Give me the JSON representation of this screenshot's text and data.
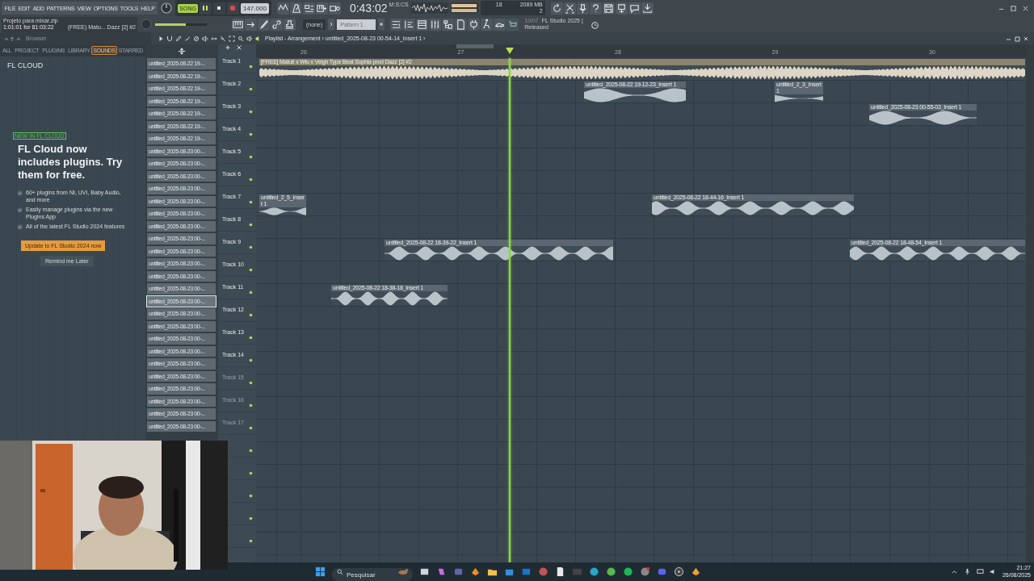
{
  "menu": [
    "FILE",
    "EDIT",
    "ADD",
    "PATTERNS",
    "VIEW",
    "OPTIONS",
    "TOOLS",
    "HELP"
  ],
  "hint_panel": {
    "title": "Projeto para mixar.zip",
    "position": "1:01:01 for 81:03:22",
    "song": "(FREE) Matu... Dazz [2] #2"
  },
  "transport": {
    "mode_label": "SONG",
    "song_mode": true,
    "playing": true,
    "tempo": "147.000"
  },
  "master_volume": {
    "level": 0.6
  },
  "time": {
    "value": "0:43:02",
    "unit": "M:S:CS"
  },
  "cpu": {
    "value": "18",
    "memory": "2089 MB",
    "polyphony": "2"
  },
  "pattern": {
    "mixer_target": "(none)",
    "name": "Pattern 1"
  },
  "news": {
    "date": "10/07",
    "title": "FL Studio 2025 |",
    "subtitle": "Released"
  },
  "browser": {
    "title": "Browser",
    "tabs": [
      {
        "label": "ALL",
        "selected": false
      },
      {
        "label": "PROJECT",
        "selected": false
      },
      {
        "label": "PLUGINS",
        "selected": false
      },
      {
        "label": "LIBRARY",
        "selected": false
      },
      {
        "label": "SOUNDS",
        "selected": true
      },
      {
        "label": "STARRED",
        "selected": false
      }
    ],
    "heading": "FL CLOUD",
    "promo": {
      "badge": "NEW IN FL CLOUD",
      "headline": "FL Cloud now includes plugins. Try them for free.",
      "features": [
        "60+ plugins from NI, UVI, Baby Audio, and more",
        "Easily manage plugins via the new Plugins App",
        "All of the latest FL Studio 2024 features"
      ],
      "primary_button": "Update to FL Studio 2024 now",
      "secondary_button": "Remind me Later"
    }
  },
  "playlist": {
    "breadcrumb": "Playlist - Arrangement › untitled_2025-08-23 00-54-14_Insert 1 ›",
    "picker": [
      {
        "label": "untitled_2025-08-22 19-...",
        "selected": false
      },
      {
        "label": "untitled_2025-08-22 19-...",
        "selected": false
      },
      {
        "label": "untitled_2025-08-22 19-...",
        "selected": false
      },
      {
        "label": "untitled_2025-08-22 19-...",
        "selected": false
      },
      {
        "label": "untitled_2025-08-22 19-...",
        "selected": false
      },
      {
        "label": "untitled_2025-08-22 19-...",
        "selected": false
      },
      {
        "label": "untitled_2025-08-22 19-...",
        "selected": false
      },
      {
        "label": "untitled_2025-08-23 00-...",
        "selected": false
      },
      {
        "label": "untitled_2025-08-23 00-...",
        "selected": false
      },
      {
        "label": "untitled_2025-08-23 00-...",
        "selected": false
      },
      {
        "label": "untitled_2025-08-23 00-...",
        "selected": false
      },
      {
        "label": "untitled_2025-08-23 00-...",
        "selected": false
      },
      {
        "label": "untitled_2025-08-23 00-...",
        "selected": false
      },
      {
        "label": "untitled_2025-08-23 00-...",
        "selected": false
      },
      {
        "label": "untitled_2025-08-23 00-...",
        "selected": false
      },
      {
        "label": "untitled_2025-08-23 00-...",
        "selected": false
      },
      {
        "label": "untitled_2025-08-23 00-...",
        "selected": false
      },
      {
        "label": "untitled_2025-08-23 00-...",
        "selected": false
      },
      {
        "label": "untitled_2025-08-23 00-...",
        "selected": false
      },
      {
        "label": "untitled_2025-08-23 00-...",
        "selected": true
      },
      {
        "label": "untitled_2025-08-23 00-...",
        "selected": false
      },
      {
        "label": "untitled_2025-08-23 00-...",
        "selected": false
      },
      {
        "label": "untitled_2025-08-23 00-...",
        "selected": false
      },
      {
        "label": "untitled_2025-08-23 00-...",
        "selected": false
      },
      {
        "label": "untitled_2025-08-23 00-...",
        "selected": false
      },
      {
        "label": "untitled_2025-08-23 00-...",
        "selected": false
      },
      {
        "label": "untitled_2025-08-23 00-...",
        "selected": false
      },
      {
        "label": "untitled_2025-08-23 00-...",
        "selected": false
      },
      {
        "label": "untitled_2025-08-23 00-...",
        "selected": false
      },
      {
        "label": "untitled_2025-08-23 00-...",
        "selected": false
      }
    ],
    "ruler": [
      "26",
      "27",
      "28",
      "29",
      "30"
    ],
    "tracks": [
      {
        "name": "Track 1",
        "dimmed": false,
        "clips": [
          {
            "label": "[FREE] Matuê x Wiu x Veigh Type Beat  Sophia  prod  Dazz [2] #2",
            "color": "#8a8568"
          }
        ]
      },
      {
        "name": "Track 2",
        "dimmed": false,
        "clips": [
          {
            "label": "untitled_2025-08-22 19-12-23_Insert 1",
            "color": "#5b6670"
          },
          {
            "label": "untitled_2_3_Insert 1",
            "color": "#5b6670"
          }
        ]
      },
      {
        "name": "Track 3",
        "dimmed": false,
        "clips": [
          {
            "label": "untitled_2025-08-23 00-55-03_Insert 1",
            "color": "#5b6670"
          }
        ]
      },
      {
        "name": "Track 4",
        "dimmed": false
      },
      {
        "name": "Track 5",
        "dimmed": false
      },
      {
        "name": "Track 6",
        "dimmed": false
      },
      {
        "name": "Track 7",
        "dimmed": false,
        "clips": [
          {
            "label": "untitled_2_5_Insert 1",
            "color": "#5b6670"
          },
          {
            "label": "untitled_2025-08-22 18-44-16_Insert 1",
            "color": "#5b6670"
          }
        ]
      },
      {
        "name": "Track 8",
        "dimmed": false
      },
      {
        "name": "Track 9",
        "dimmed": false,
        "clips": [
          {
            "label": "untitled_2025-08-22 18-39-22_Insert 1",
            "color": "#5b6670"
          },
          {
            "label": "untitled_2025-08-22 18-48-54_Insert 1",
            "color": "#5b6670"
          }
        ]
      },
      {
        "name": "Track 10",
        "dimmed": false
      },
      {
        "name": "Track 11",
        "dimmed": false,
        "clips": [
          {
            "label": "untitled_2025-08-22 18-38-18_Insert 1",
            "color": "#5b6670"
          }
        ]
      },
      {
        "name": "Track 12",
        "dimmed": false
      },
      {
        "name": "Track 13",
        "dimmed": false
      },
      {
        "name": "Track 14",
        "dimmed": false
      },
      {
        "name": "Track 15",
        "dimmed": true
      },
      {
        "name": "Track 16",
        "dimmed": true
      },
      {
        "name": "Track 17",
        "dimmed": true
      }
    ]
  },
  "taskbar": {
    "search_placeholder": "Pesquisar",
    "time": "21:27",
    "date": "26/08/2025"
  }
}
